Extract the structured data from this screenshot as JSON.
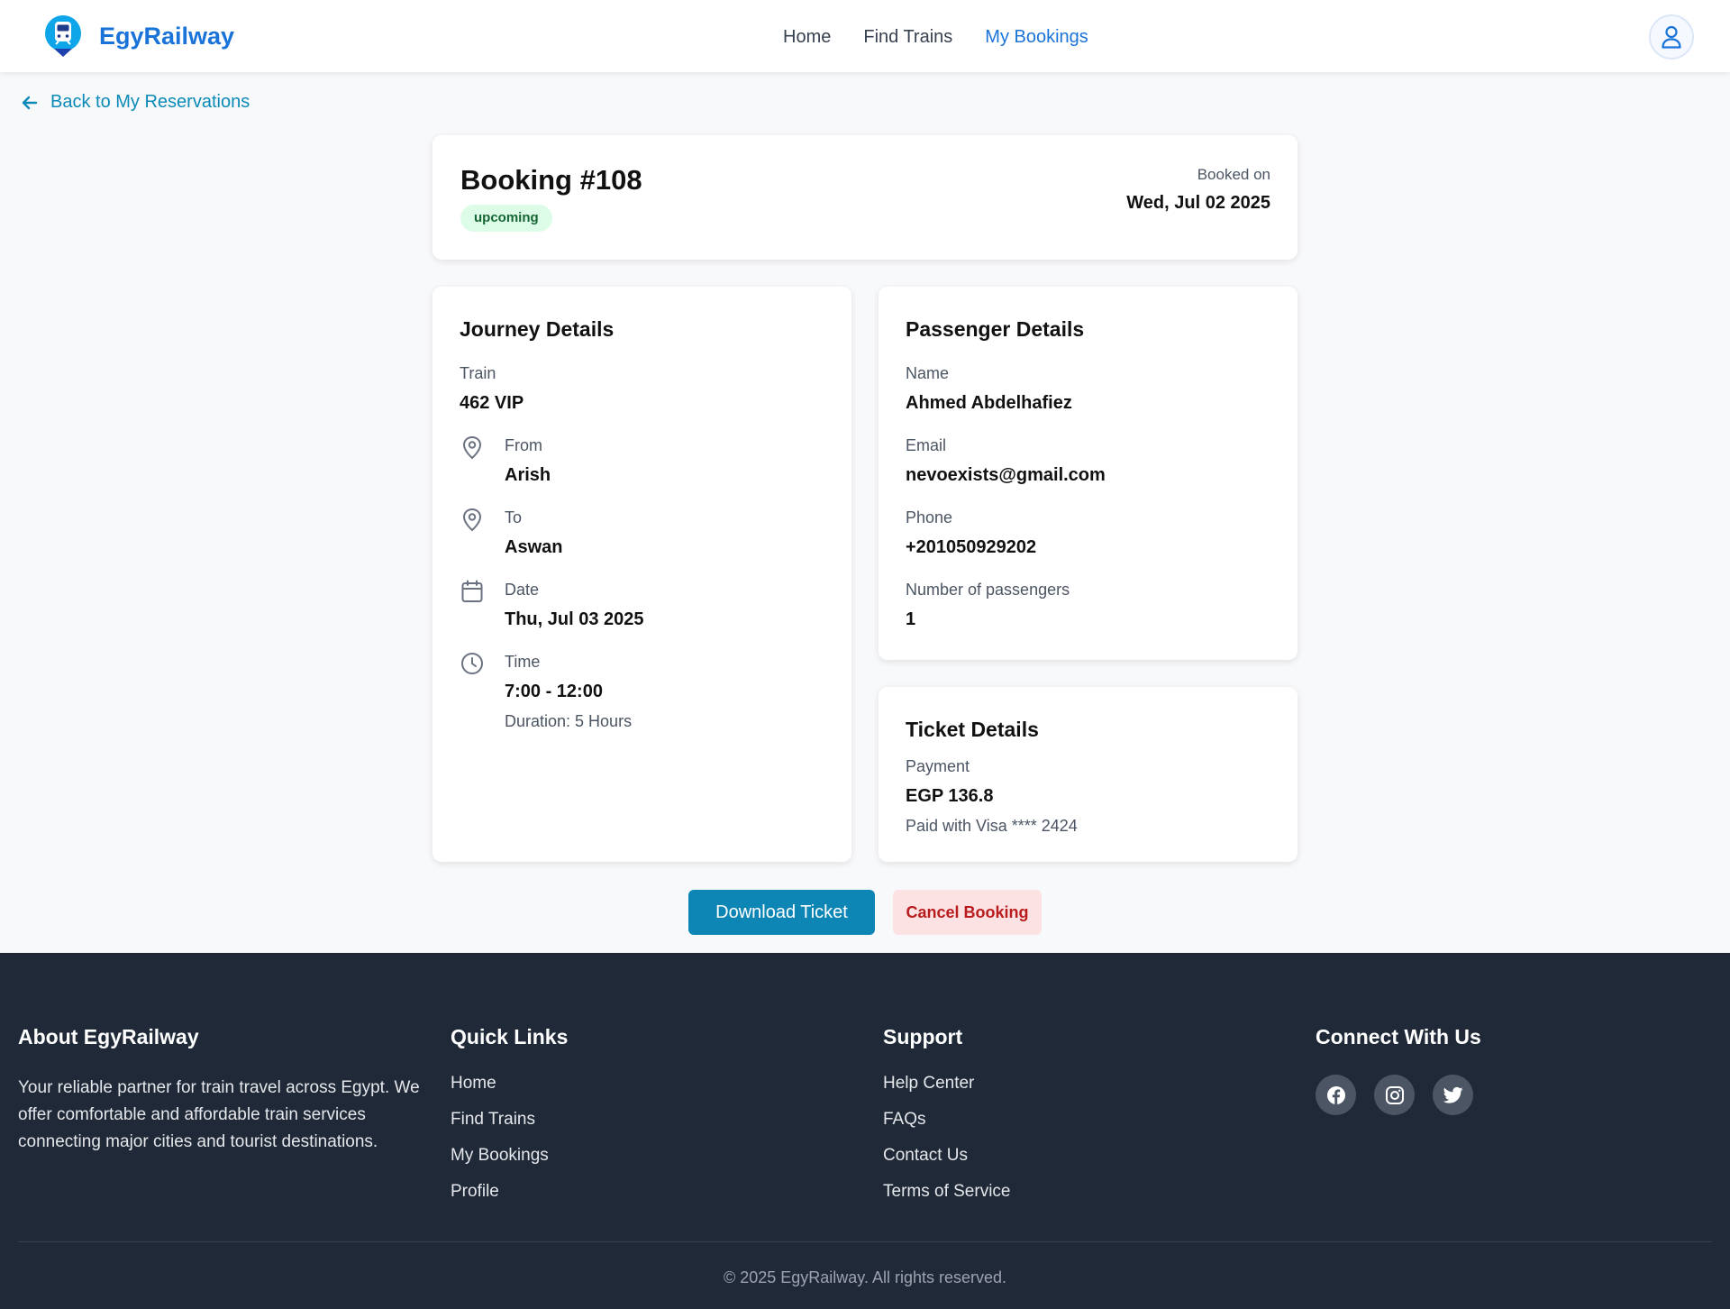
{
  "header": {
    "brand": "EgyRailway",
    "nav": [
      {
        "label": "Home"
      },
      {
        "label": "Find Trains"
      },
      {
        "label": "My Bookings"
      }
    ]
  },
  "back_link": "Back to My Reservations",
  "booking": {
    "title": "Booking #108",
    "status": "upcoming",
    "booked_label": "Booked on",
    "booked_date": "Wed, Jul 02 2025"
  },
  "journey": {
    "title": "Journey Details",
    "train_label": "Train",
    "train_value": "462 VIP",
    "from_label": "From",
    "from_value": "Arish",
    "to_label": "To",
    "to_value": "Aswan",
    "date_label": "Date",
    "date_value": "Thu, Jul 03 2025",
    "time_label": "Time",
    "time_value": "7:00 - 12:00",
    "duration": "Duration: 5 Hours"
  },
  "passenger": {
    "title": "Passenger Details",
    "name_label": "Name",
    "name_value": "Ahmed Abdelhafiez",
    "email_label": "Email",
    "email_value": "nevoexists@gmail.com",
    "phone_label": "Phone",
    "phone_value": "+201050929202",
    "count_label": "Number of passengers",
    "count_value": "1"
  },
  "ticket": {
    "title": "Ticket Details",
    "payment_label": "Payment",
    "payment_value": "EGP 136.8",
    "payment_method": "Paid with Visa **** 2424"
  },
  "actions": {
    "download": "Download Ticket",
    "cancel": "Cancel Booking"
  },
  "footer": {
    "about_title": "About EgyRailway",
    "about_text": "Your reliable partner for train travel across Egypt. We offer comfortable and affordable train services connecting major cities and tourist destinations.",
    "quick_title": "Quick Links",
    "quick_links": [
      "Home",
      "Find Trains",
      "My Bookings",
      "Profile"
    ],
    "support_title": "Support",
    "support_links": [
      "Help Center",
      "FAQs",
      "Contact Us",
      "Terms of Service"
    ],
    "connect_title": "Connect With Us",
    "copyright": "© 2025 EgyRailway. All rights reserved."
  },
  "colors": {
    "brand": "#1a73d9",
    "accent": "#0e86b5",
    "footer_bg": "#1f2937",
    "badge_bg": "#dcfce7",
    "cancel_bg": "#fde2e4"
  }
}
